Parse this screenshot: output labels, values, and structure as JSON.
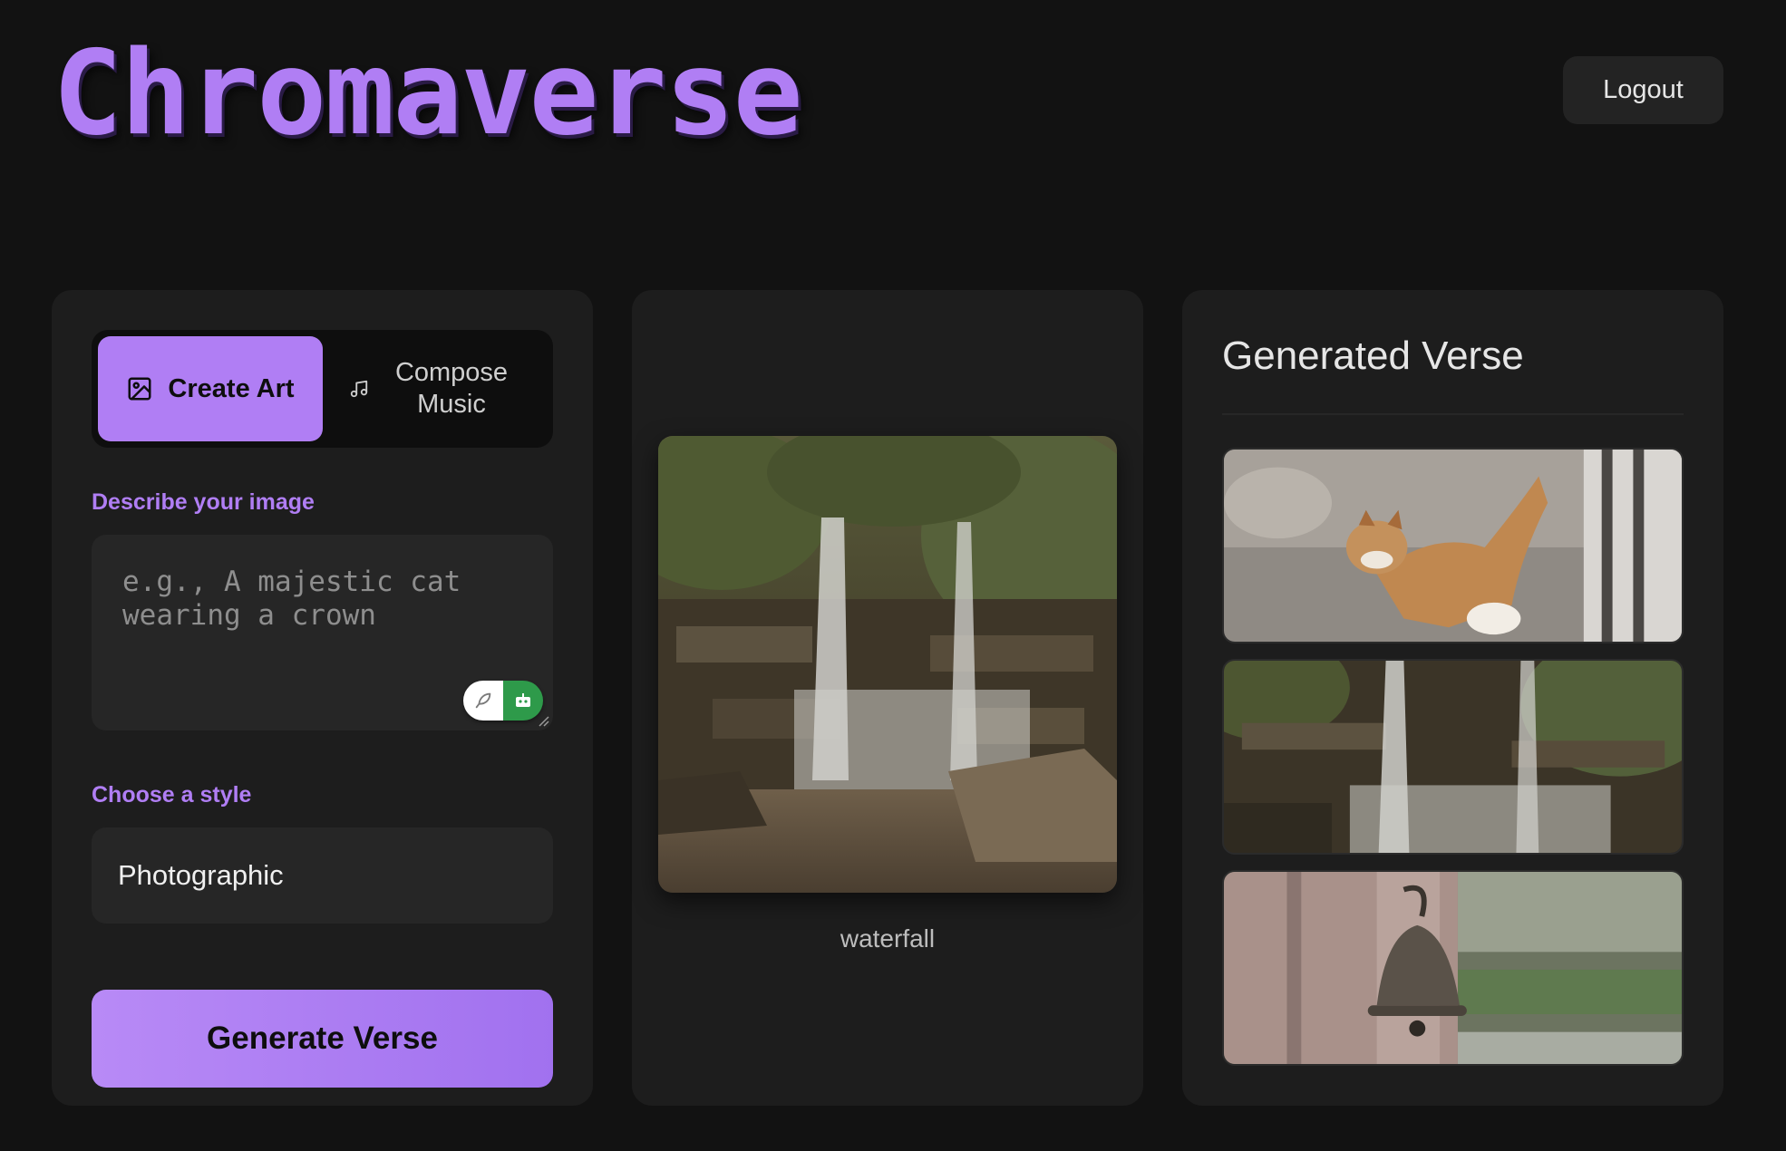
{
  "header": {
    "brand": "Chromaverse",
    "logout_label": "Logout"
  },
  "tabs": [
    {
      "label": "Create Art",
      "icon": "image-icon",
      "active": true
    },
    {
      "label": "Compose Music",
      "icon": "music-note-icon",
      "active": false
    }
  ],
  "form": {
    "describe_label": "Describe your image",
    "describe_placeholder": "e.g., A majestic cat wearing a crown",
    "describe_value": "",
    "style_label": "Choose a style",
    "style_value": "Photographic",
    "generate_label": "Generate Verse"
  },
  "preview": {
    "image": "waterfall-image",
    "caption": "waterfall"
  },
  "verse": {
    "title": "Generated Verse",
    "items": [
      {
        "image": "cat-image"
      },
      {
        "image": "waterfall-image"
      },
      {
        "image": "bell-image"
      }
    ]
  },
  "colors": {
    "accent": "#b07ef4",
    "background": "#121212",
    "panel": "#1d1d1d",
    "input": "#262626"
  }
}
